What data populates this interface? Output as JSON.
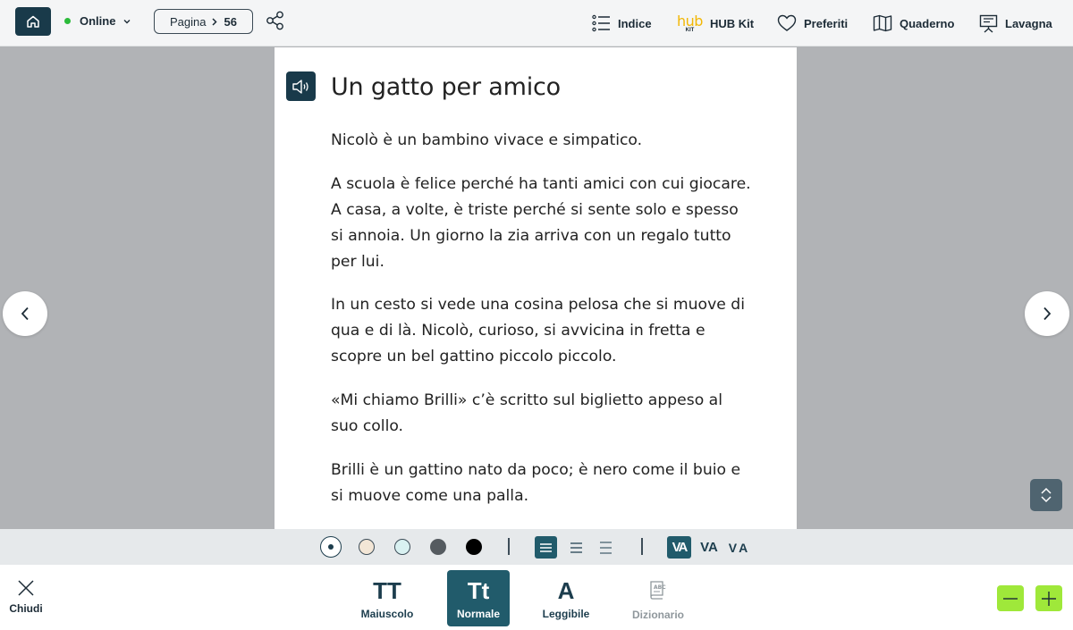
{
  "topbar": {
    "status": "Online",
    "page": {
      "label": "Pagina",
      "number": "56"
    },
    "nav": {
      "indice": "Indice",
      "hub_logo": "hub",
      "hub_kit_small": "KIT",
      "hub_kit": "HUB Kit",
      "preferiti": "Preferiti",
      "quaderno": "Quaderno",
      "lavagna": "Lavagna"
    },
    "icons": [
      "home-icon",
      "chevron-down-icon",
      "chevron-right-icon",
      "share-icon",
      "list-icon",
      "heart-icon",
      "book-open-icon",
      "whiteboard-icon"
    ]
  },
  "reader": {
    "title": "Un gatto per amico",
    "paragraphs": [
      "Nicolò è un bambino vivace e simpatico.",
      "A scuola è felice perché ha tanti amici con cui giocare. A casa, a volte, è triste perché si sente solo e spesso si annoia. Un giorno la zia arriva con un regalo tutto per lui.",
      "In un cesto si vede una cosina pelosa che si muove di qua e di là. Nicolò, curioso, si avvicina in fretta e scopre un bel gattino piccolo piccolo.",
      "«Mi chiamo Brilli» c’è scritto sul biglietto appeso al suo collo.",
      "Brilli è un gattino nato da poco; è nero come il buio e si muove come una palla."
    ]
  },
  "options": {
    "background_colors": [
      "#ffffff",
      "#f3e6d6",
      "#d9f1f1",
      "#555b60",
      "#000000"
    ],
    "spacing_labels": [
      "VA",
      "VA",
      "VA"
    ]
  },
  "toolbar": {
    "close_label": "Chiudi",
    "font_options": [
      {
        "glyph": "TT",
        "label": "Maiuscolo"
      },
      {
        "glyph": "Tt",
        "label": "Normale"
      },
      {
        "glyph": "A",
        "label": "Leggibile"
      },
      {
        "label": "Dizionario"
      }
    ]
  },
  "colors": {
    "brand_dark": "#193a4a",
    "active_teal": "#215b6b",
    "online_green": "#2bbb3a",
    "zoom_green": "#9fe83a",
    "hub_yellow": "#f2b705"
  }
}
